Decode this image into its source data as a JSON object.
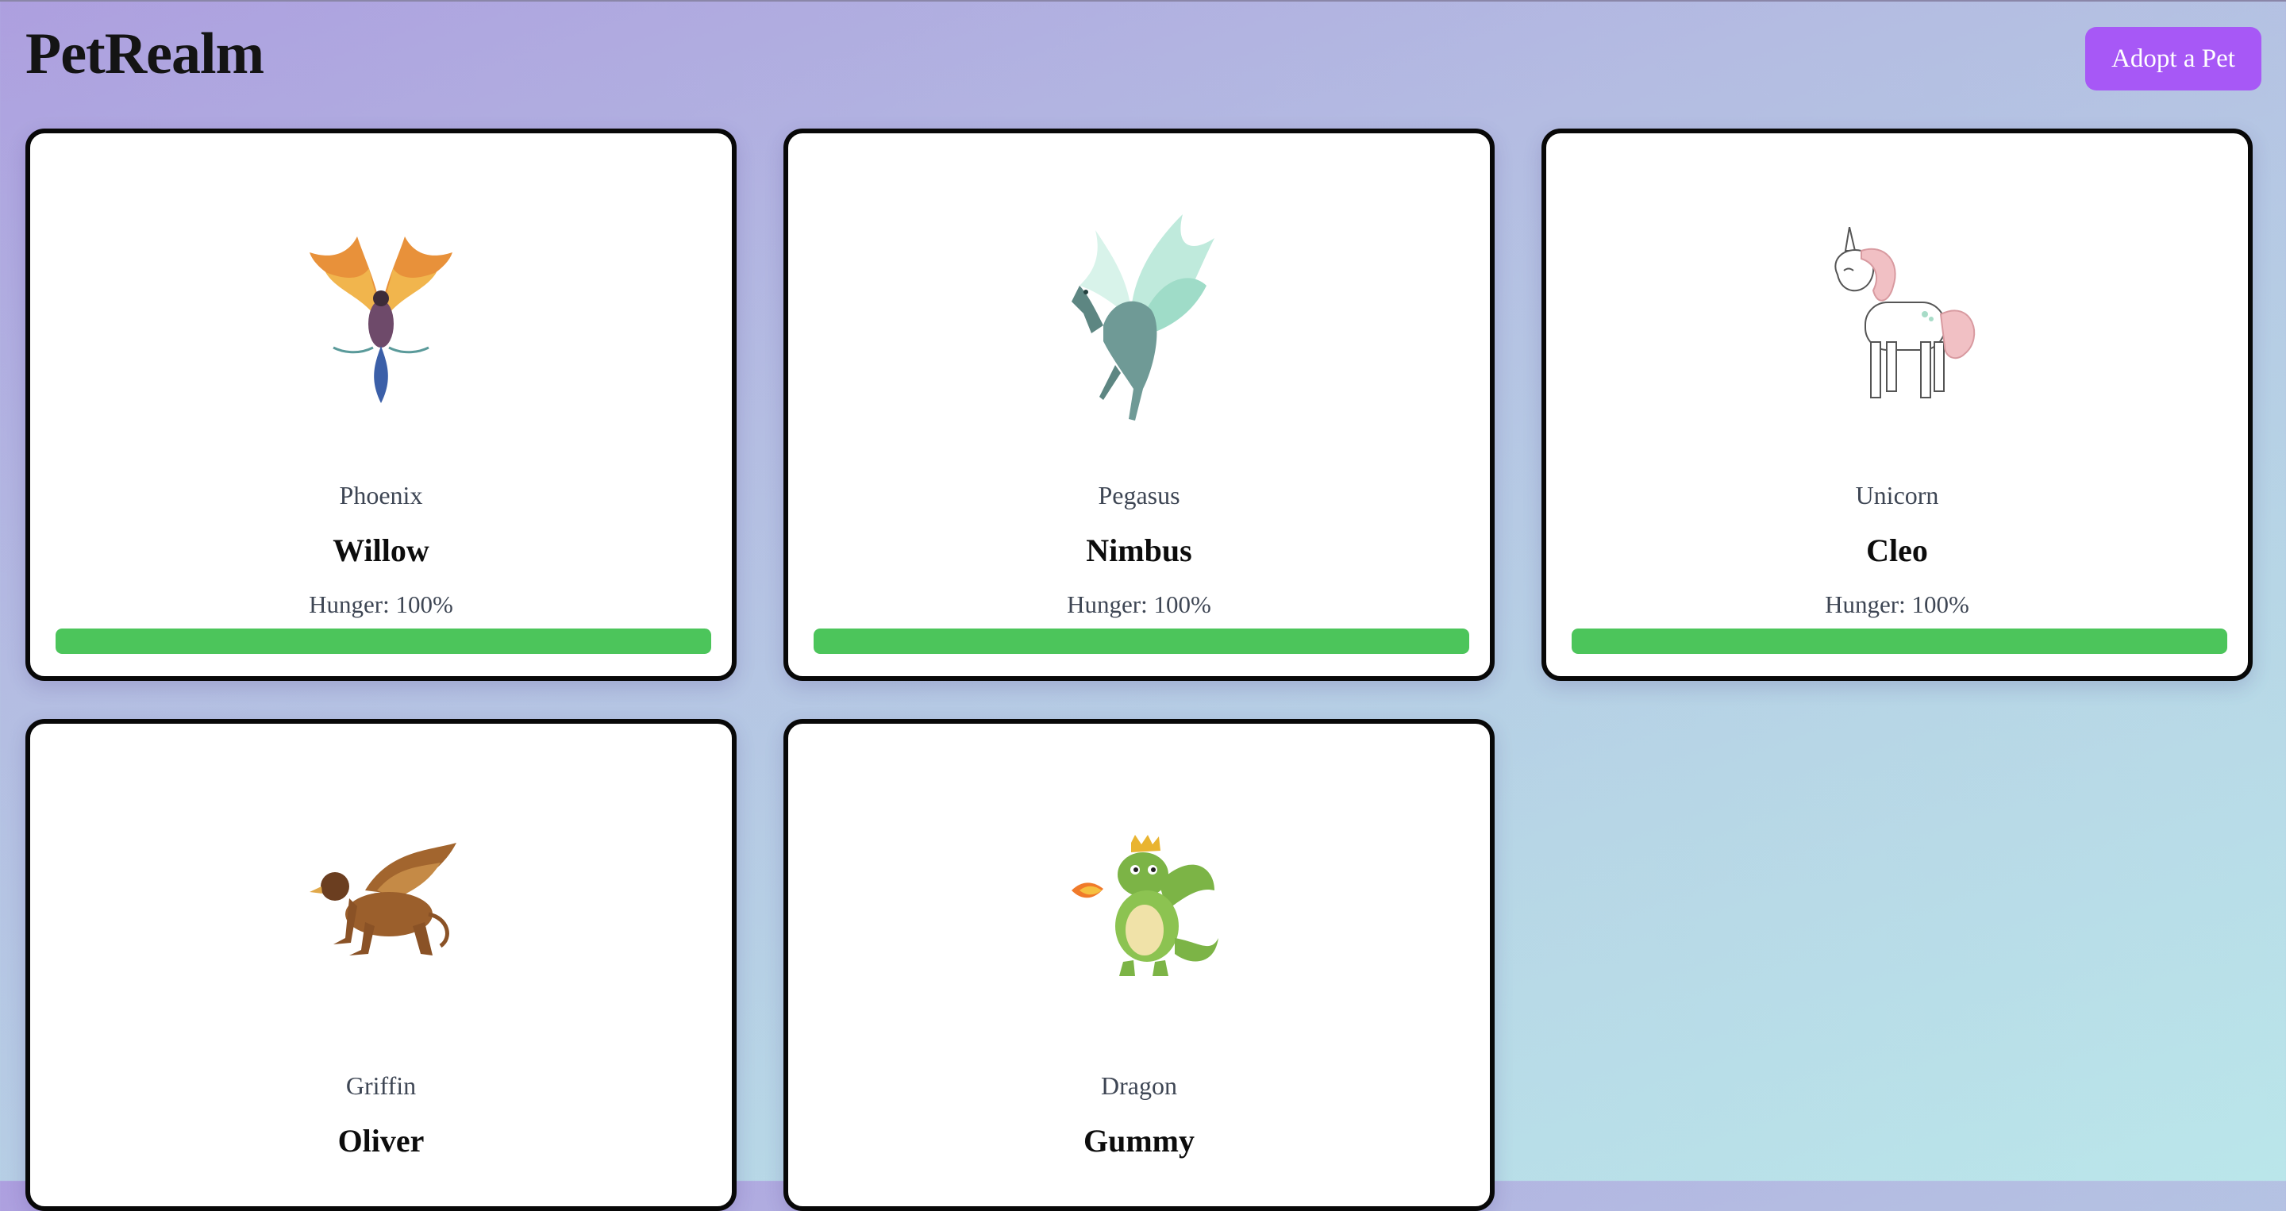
{
  "app": {
    "logo": "PetRealm",
    "adopt_button_label": "Adopt a Pet",
    "accent_color": "#a758f6",
    "bar_color": "#4cc55b"
  },
  "pets": [
    {
      "species": "Phoenix",
      "name": "Willow",
      "hunger_label": "Hunger:",
      "hunger_value": "100%",
      "hunger_fraction": 1.0,
      "image": "phoenix-image"
    },
    {
      "species": "Pegasus",
      "name": "Nimbus",
      "hunger_label": "Hunger:",
      "hunger_value": "100%",
      "hunger_fraction": 1.0,
      "image": "pegasus-image"
    },
    {
      "species": "Unicorn",
      "name": "Cleo",
      "hunger_label": "Hunger:",
      "hunger_value": "100%",
      "hunger_fraction": 1.0,
      "image": "unicorn-image"
    },
    {
      "species": "Griffin",
      "name": "Oliver",
      "image": "griffin-image"
    },
    {
      "species": "Dragon",
      "name": "Gummy",
      "image": "dragon-image"
    }
  ]
}
